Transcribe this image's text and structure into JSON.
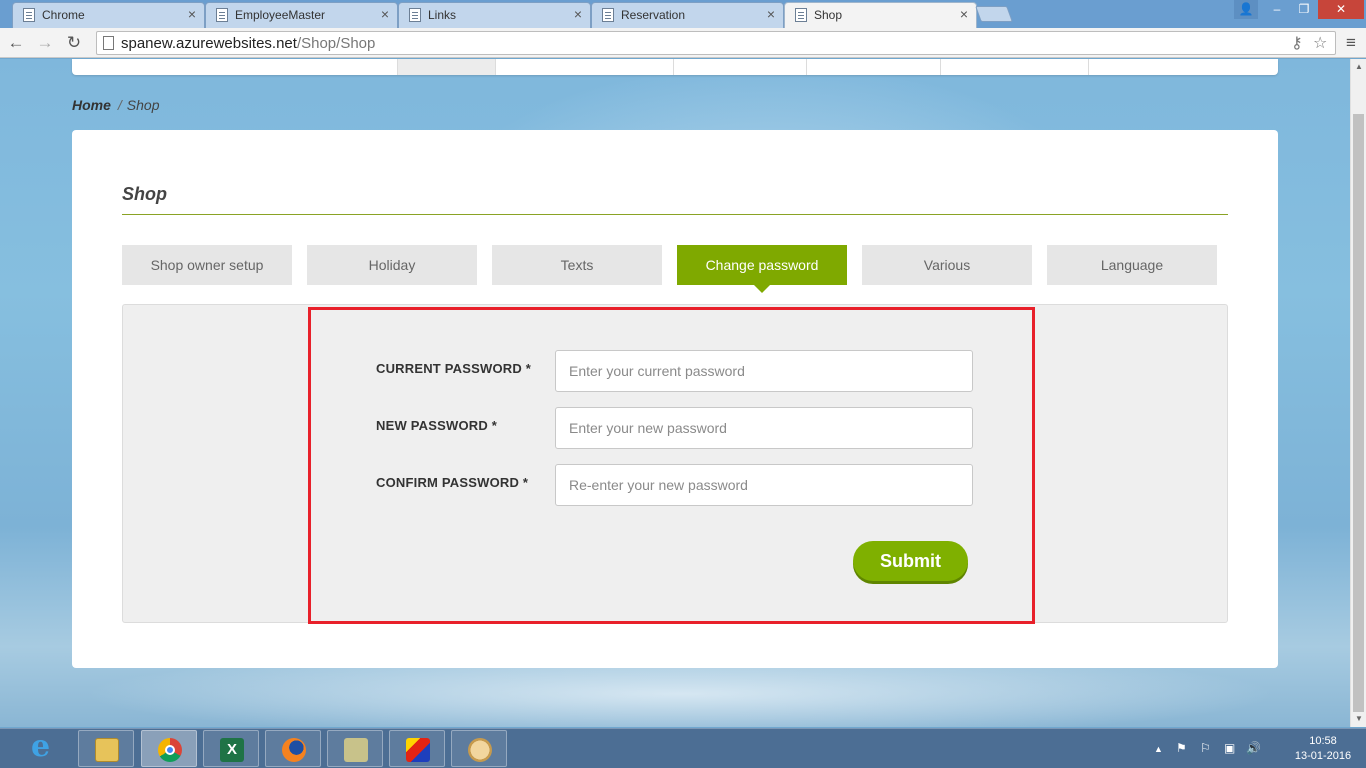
{
  "browser": {
    "tabs": [
      {
        "title": "Chrome",
        "active": false
      },
      {
        "title": "EmployeeMaster",
        "active": false
      },
      {
        "title": "Links",
        "active": false
      },
      {
        "title": "Reservation",
        "active": false
      },
      {
        "title": "Shop",
        "active": true
      }
    ],
    "tab_close": "×",
    "url_host": "spanew.azurewebsites.net",
    "url_path": "/Shop/Shop",
    "nav": {
      "back": "←",
      "forward": "→",
      "reload": "↻",
      "menu": "≡",
      "star": "☆",
      "key": "⚷"
    },
    "window": {
      "minimize": "–",
      "maximize": "❐",
      "close": "✕",
      "user": "👤"
    }
  },
  "breadcrumb": {
    "home": "Home",
    "separator": "/",
    "current": "Shop"
  },
  "page": {
    "title": "Shop",
    "tabs": [
      {
        "label": "Shop owner setup",
        "active": false
      },
      {
        "label": "Holiday",
        "active": false
      },
      {
        "label": "Texts",
        "active": false
      },
      {
        "label": "Change password",
        "active": true
      },
      {
        "label": "Various",
        "active": false
      },
      {
        "label": "Language",
        "active": false
      }
    ],
    "form": {
      "current_label": "CURRENT PASSWORD *",
      "current_placeholder": "Enter your current password",
      "current_value": "",
      "new_label": "NEW PASSWORD *",
      "new_placeholder": "Enter your new password",
      "new_value": "",
      "confirm_label": "CONFIRM PASSWORD *",
      "confirm_placeholder": "Re-enter your new password",
      "confirm_value": "",
      "submit_label": "Submit"
    },
    "colors": {
      "accent": "#7fa900",
      "highlight_border": "#e8202a",
      "rule": "#8aa324"
    }
  },
  "taskbar": {
    "apps": [
      {
        "name": "internet-explorer",
        "label": "e"
      },
      {
        "name": "file-explorer",
        "label": ""
      },
      {
        "name": "chrome",
        "label": "",
        "active": true
      },
      {
        "name": "excel",
        "label": "X"
      },
      {
        "name": "firefox",
        "label": ""
      },
      {
        "name": "tools",
        "label": ""
      },
      {
        "name": "paint",
        "label": ""
      },
      {
        "name": "art",
        "label": ""
      }
    ],
    "tray": {
      "up_arrow": "▲",
      "volume": "🔊"
    },
    "clock_time": "10:58",
    "clock_date": "13-01-2016"
  }
}
